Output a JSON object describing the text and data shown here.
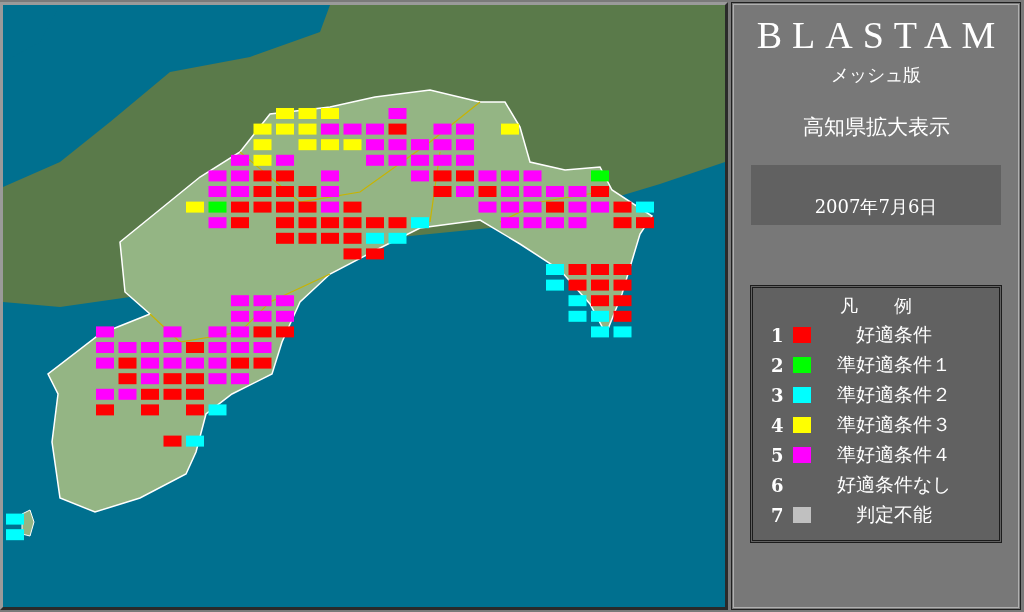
{
  "title": "BLASTAM",
  "subtitle": "メッシュ版",
  "region": "高知県拡大表示",
  "date": "2007年7月6日",
  "legend": {
    "title": "凡　　例",
    "items": [
      {
        "number": "1",
        "label": "好適条件",
        "color": "#ff0000"
      },
      {
        "number": "2",
        "label": "準好適条件１",
        "color": "#00ff00"
      },
      {
        "number": "3",
        "label": "準好適条件２",
        "color": "#00ffff"
      },
      {
        "number": "4",
        "label": "準好適条件３",
        "color": "#ffff00"
      },
      {
        "number": "5",
        "label": "準好適条件４",
        "color": "#ff00ff"
      },
      {
        "number": "6",
        "label": "好適条件なし"
      },
      {
        "number": "7",
        "label": "判定不能",
        "color": "#c0c0c0"
      }
    ]
  },
  "mesh": {
    "rows": [
      {
        "cells": [
          {},
          {},
          {},
          {},
          {},
          {},
          {},
          {},
          {},
          {},
          {},
          {},
          {
            "color": "#ffff00"
          },
          {
            "color": "#ffff00"
          },
          {
            "color": "#ffff00"
          },
          {},
          {},
          {
            "color": "#ff00ff"
          }
        ]
      },
      {
        "cells": [
          {},
          {},
          {},
          {},
          {},
          {},
          {},
          {},
          {},
          {},
          {},
          {
            "color": "#ffff00"
          },
          {
            "color": "#ffff00"
          },
          {
            "color": "#ffff00"
          },
          {
            "color": "#ff00ff"
          },
          {
            "color": "#ff00ff"
          },
          {
            "color": "#ff00ff"
          },
          {
            "color": "#ff0000"
          },
          {},
          {
            "color": "#ff00ff"
          },
          {
            "color": "#ff00ff"
          },
          {},
          {
            "color": "#ffff00"
          }
        ]
      },
      {
        "cells": [
          {},
          {},
          {},
          {},
          {},
          {},
          {},
          {},
          {},
          {},
          {},
          {
            "color": "#ffff00"
          },
          {},
          {
            "color": "#ffff00"
          },
          {
            "color": "#ffff00"
          },
          {
            "color": "#ffff00"
          },
          {
            "color": "#ff00ff"
          },
          {
            "color": "#ff00ff"
          },
          {
            "color": "#ff00ff"
          },
          {
            "color": "#ff00ff"
          },
          {
            "color": "#ff00ff"
          }
        ]
      },
      {
        "cells": [
          {},
          {},
          {},
          {},
          {},
          {},
          {},
          {},
          {},
          {},
          {
            "color": "#ff00ff"
          },
          {
            "color": "#ffff00"
          },
          {
            "color": "#ff00ff"
          },
          {},
          {},
          {},
          {
            "color": "#ff00ff"
          },
          {
            "color": "#ff00ff"
          },
          {
            "color": "#ff00ff"
          },
          {
            "color": "#ff00ff"
          },
          {
            "color": "#ff00ff"
          }
        ]
      },
      {
        "cells": [
          {},
          {},
          {},
          {},
          {},
          {},
          {},
          {},
          {},
          {
            "color": "#ff00ff"
          },
          {
            "color": "#ff00ff"
          },
          {
            "color": "#ff0000"
          },
          {
            "color": "#ff0000"
          },
          {},
          {
            "color": "#ff00ff"
          },
          {},
          {},
          {},
          {
            "color": "#ff00ff"
          },
          {
            "color": "#ff0000"
          },
          {
            "color": "#ff0000"
          },
          {
            "color": "#ff00ff"
          },
          {
            "color": "#ff00ff"
          },
          {
            "color": "#ff00ff"
          },
          {},
          {},
          {
            "color": "#00ff00"
          }
        ]
      },
      {
        "cells": [
          {},
          {},
          {},
          {},
          {},
          {},
          {},
          {},
          {},
          {
            "color": "#ff00ff"
          },
          {
            "color": "#ff00ff"
          },
          {
            "color": "#ff0000"
          },
          {
            "color": "#ff0000"
          },
          {
            "color": "#ff0000"
          },
          {
            "color": "#ff00ff"
          },
          {},
          {},
          {},
          {},
          {
            "color": "#ff0000"
          },
          {
            "color": "#ff00ff"
          },
          {
            "color": "#ff0000"
          },
          {
            "color": "#ff00ff"
          },
          {
            "color": "#ff00ff"
          },
          {
            "color": "#ff00ff"
          },
          {
            "color": "#ff00ff"
          },
          {
            "color": "#ff0000"
          }
        ]
      },
      {
        "cells": [
          {},
          {},
          {},
          {},
          {},
          {},
          {},
          {},
          {
            "color": "#ffff00"
          },
          {
            "color": "#00ff00"
          },
          {
            "color": "#ff0000"
          },
          {
            "color": "#ff0000"
          },
          {
            "color": "#ff0000"
          },
          {
            "color": "#ff0000"
          },
          {
            "color": "#ff00ff"
          },
          {
            "color": "#ff0000"
          },
          {},
          {},
          {},
          {},
          {},
          {
            "color": "#ff00ff"
          },
          {
            "color": "#ff00ff"
          },
          {
            "color": "#ff00ff"
          },
          {
            "color": "#ff0000"
          },
          {
            "color": "#ff00ff"
          },
          {
            "color": "#ff00ff"
          },
          {
            "color": "#ff0000"
          },
          {
            "color": "#00ffff"
          }
        ]
      },
      {
        "cells": [
          {},
          {},
          {},
          {},
          {},
          {},
          {},
          {},
          {},
          {
            "color": "#ff00ff"
          },
          {
            "color": "#ff0000"
          },
          {},
          {
            "color": "#ff0000"
          },
          {
            "color": "#ff0000"
          },
          {
            "color": "#ff0000"
          },
          {
            "color": "#ff0000"
          },
          {
            "color": "#ff0000"
          },
          {
            "color": "#ff0000"
          },
          {
            "color": "#00ffff"
          },
          {},
          {},
          {},
          {
            "color": "#ff00ff"
          },
          {
            "color": "#ff00ff"
          },
          {
            "color": "#ff00ff"
          },
          {
            "color": "#ff00ff"
          },
          {},
          {
            "color": "#ff0000"
          },
          {
            "color": "#ff0000"
          }
        ]
      },
      {
        "cells": [
          {},
          {},
          {},
          {},
          {},
          {},
          {},
          {},
          {},
          {},
          {},
          {},
          {
            "color": "#ff0000"
          },
          {
            "color": "#ff0000"
          },
          {
            "color": "#ff0000"
          },
          {
            "color": "#ff0000"
          },
          {
            "color": "#00ffff"
          },
          {
            "color": "#00ffff"
          }
        ]
      },
      {
        "cells": [
          {},
          {},
          {},
          {},
          {},
          {},
          {},
          {},
          {},
          {},
          {},
          {},
          {},
          {},
          {},
          {
            "color": "#ff0000"
          },
          {
            "color": "#ff0000"
          }
        ]
      },
      {
        "cells": [
          {},
          {},
          {},
          {},
          {},
          {},
          {},
          {},
          {},
          {},
          {},
          {},
          {},
          {},
          {},
          {},
          {},
          {},
          {},
          {},
          {},
          {},
          {},
          {},
          {
            "color": "#00ffff"
          },
          {
            "color": "#ff0000"
          },
          {
            "color": "#ff0000"
          },
          {
            "color": "#ff0000"
          }
        ]
      },
      {
        "cells": [
          {},
          {},
          {},
          {},
          {},
          {},
          {},
          {},
          {},
          {},
          {},
          {},
          {},
          {},
          {},
          {},
          {},
          {},
          {},
          {},
          {},
          {},
          {},
          {},
          {
            "color": "#00ffff"
          },
          {
            "color": "#ff0000"
          },
          {
            "color": "#ff0000"
          },
          {
            "color": "#ff0000"
          }
        ]
      },
      {
        "cells": [
          {},
          {},
          {},
          {},
          {},
          {},
          {},
          {},
          {},
          {},
          {
            "color": "#ff00ff"
          },
          {
            "color": "#ff00ff"
          },
          {
            "color": "#ff00ff"
          },
          {},
          {},
          {},
          {},
          {},
          {},
          {},
          {},
          {},
          {},
          {},
          {},
          {
            "color": "#00ffff"
          },
          {
            "color": "#ff0000"
          },
          {
            "color": "#ff0000"
          }
        ]
      },
      {
        "cells": [
          {},
          {},
          {},
          {},
          {},
          {},
          {},
          {},
          {},
          {},
          {
            "color": "#ff00ff"
          },
          {
            "color": "#ff00ff"
          },
          {
            "color": "#ff00ff"
          },
          {},
          {},
          {},
          {},
          {},
          {},
          {},
          {},
          {},
          {},
          {},
          {},
          {
            "color": "#00ffff"
          },
          {
            "color": "#00ffff"
          },
          {
            "color": "#ff0000"
          }
        ]
      },
      {
        "cells": [
          {},
          {},
          {},
          {},
          {
            "color": "#ff00ff"
          },
          {},
          {},
          {
            "color": "#ff00ff"
          },
          {},
          {
            "color": "#ff00ff"
          },
          {
            "color": "#ff00ff"
          },
          {
            "color": "#ff0000"
          },
          {
            "color": "#ff0000"
          },
          {},
          {},
          {},
          {},
          {},
          {},
          {},
          {},
          {},
          {},
          {},
          {},
          {},
          {
            "color": "#00ffff"
          },
          {
            "color": "#00ffff"
          }
        ]
      },
      {
        "cells": [
          {},
          {},
          {},
          {},
          {
            "color": "#ff00ff"
          },
          {
            "color": "#ff00ff"
          },
          {
            "color": "#ff00ff"
          },
          {
            "color": "#ff00ff"
          },
          {
            "color": "#ff0000"
          },
          {
            "color": "#ff00ff"
          },
          {
            "color": "#ff00ff"
          },
          {
            "color": "#ff00ff"
          }
        ]
      },
      {
        "cells": [
          {},
          {},
          {},
          {},
          {
            "color": "#ff00ff"
          },
          {
            "color": "#ff0000"
          },
          {
            "color": "#ff00ff"
          },
          {
            "color": "#ff00ff"
          },
          {
            "color": "#ff00ff"
          },
          {
            "color": "#ff00ff"
          },
          {
            "color": "#ff0000"
          },
          {
            "color": "#ff0000"
          }
        ]
      },
      {
        "cells": [
          {},
          {},
          {},
          {},
          {},
          {
            "color": "#ff0000"
          },
          {
            "color": "#ff00ff"
          },
          {
            "color": "#ff0000"
          },
          {
            "color": "#ff0000"
          },
          {
            "color": "#ff00ff"
          },
          {
            "color": "#ff00ff"
          }
        ]
      },
      {
        "cells": [
          {},
          {},
          {},
          {},
          {
            "color": "#ff00ff"
          },
          {
            "color": "#ff00ff"
          },
          {
            "color": "#ff0000"
          },
          {
            "color": "#ff0000"
          },
          {
            "color": "#ff0000"
          }
        ]
      },
      {
        "cells": [
          {},
          {},
          {},
          {},
          {
            "color": "#ff0000"
          },
          {},
          {
            "color": "#ff0000"
          },
          {},
          {
            "color": "#ff0000"
          },
          {
            "color": "#00ffff"
          }
        ]
      },
      {},
      {
        "cells": [
          {},
          {},
          {},
          {},
          {},
          {},
          {},
          {
            "color": "#ff0000"
          },
          {
            "color": "#00ffff"
          }
        ]
      },
      {},
      {},
      {},
      {},
      {
        "cells": [
          {
            "color": "#00ffff"
          }
        ]
      },
      {
        "cells": [
          {
            "color": "#00ffff"
          }
        ]
      }
    ]
  }
}
